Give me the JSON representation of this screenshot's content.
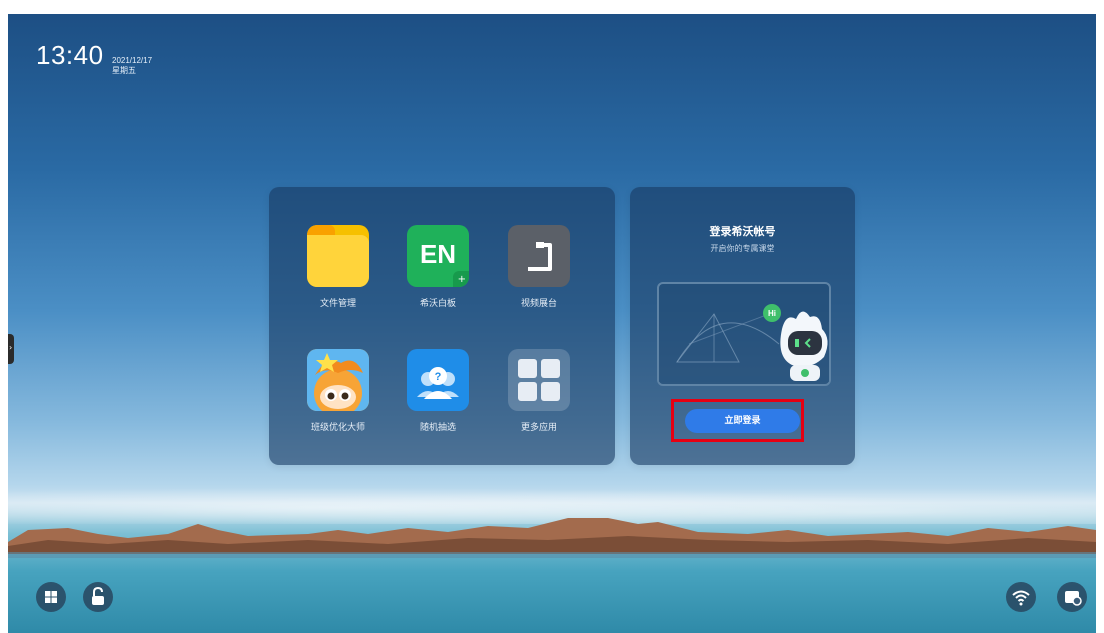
{
  "status": {
    "time": "13:40",
    "date": "2021/12/17",
    "weekday": "星期五"
  },
  "apps": [
    {
      "label": "文件管理",
      "icon": "folder-icon"
    },
    {
      "label": "希沃白板",
      "icon": "en-whiteboard-icon",
      "icon_text": "EN"
    },
    {
      "label": "视频展台",
      "icon": "document-camera-icon"
    },
    {
      "label": "班级优化大师",
      "icon": "class-master-icon"
    },
    {
      "label": "随机抽选",
      "icon": "random-pick-icon"
    },
    {
      "label": "更多应用",
      "icon": "grid-icon"
    }
  ],
  "login": {
    "title": "登录希沃帐号",
    "subtitle": "开启你的专属课堂",
    "bubble": "Hi",
    "button": "立即登录"
  },
  "side_handle": "›",
  "taskbar": {
    "left": [
      "windows-icon",
      "unlock-icon"
    ],
    "right": [
      "wifi-icon",
      "settings-card-icon"
    ]
  },
  "colors": {
    "highlight": "#e60012",
    "login_button": "#2f7be8",
    "panel": "#183a62"
  }
}
